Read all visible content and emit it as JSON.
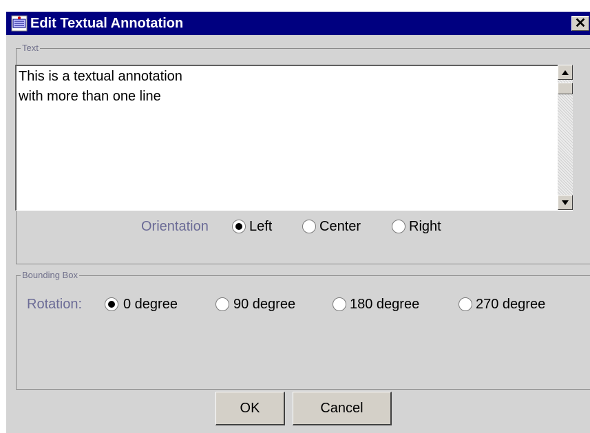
{
  "window": {
    "title": "Edit Textual Annotation",
    "close_glyph": "✕"
  },
  "text_group": {
    "legend": "Text",
    "content": "This is a textual annotation\nwith more than one line"
  },
  "orientation": {
    "label": "Orientation",
    "options": [
      "Left",
      "Center",
      "Right"
    ],
    "selected": "Left"
  },
  "bbox_group": {
    "legend": "Bounding Box"
  },
  "rotation": {
    "label": "Rotation:",
    "options": [
      "0 degree",
      "90 degree",
      "180 degree",
      "270 degree"
    ],
    "selected": "0 degree"
  },
  "buttons": {
    "ok": "OK",
    "cancel": "Cancel"
  },
  "colors": {
    "title_bar": "#000080",
    "dialog_bg": "#d4d4d4",
    "label_text": "#6b6b96"
  }
}
